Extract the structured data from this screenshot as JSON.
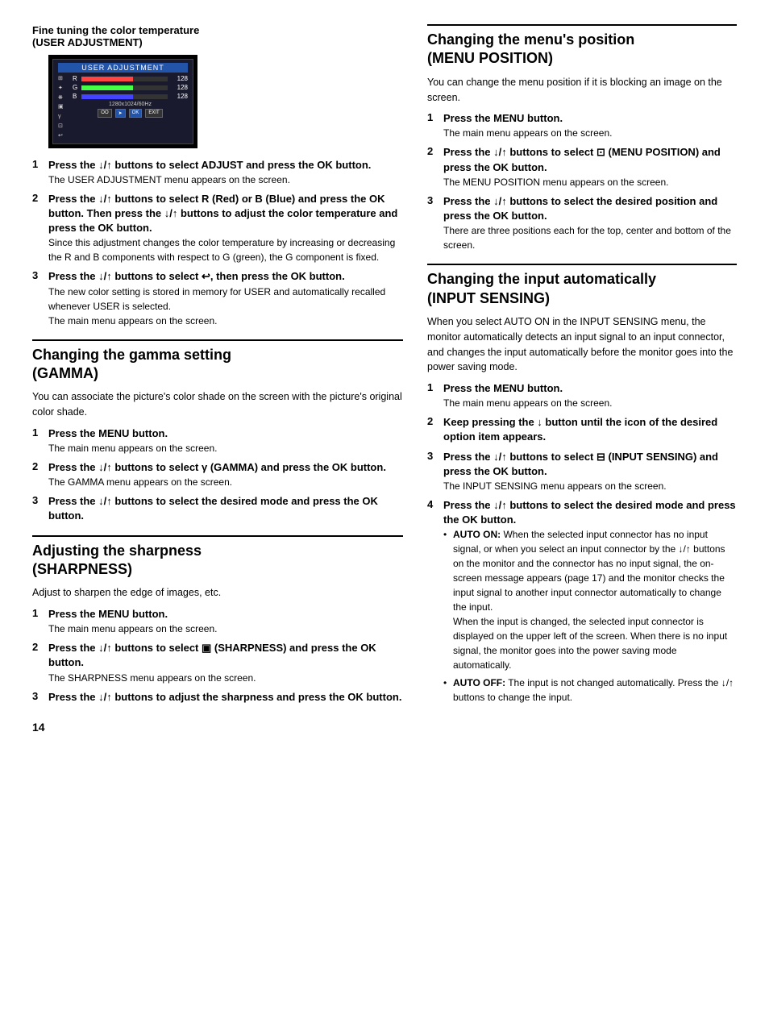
{
  "page": {
    "number": "14"
  },
  "fine_tuning": {
    "title": "Fine tuning the color temperature",
    "subtitle": "(USER ADJUSTMENT)",
    "monitor_title": "USER ADJUSTMENT",
    "monitor_res": "1280x1024/60Hz",
    "r_value": "128",
    "g_value": "128",
    "b_value": "128",
    "steps": [
      {
        "num": "1",
        "bold": "Press the ↓/↑ buttons to select ADJUST and press the OK button.",
        "desc": "The USER ADJUSTMENT menu appears on the screen."
      },
      {
        "num": "2",
        "bold": "Press the ↓/↑ buttons to select R (Red) or B (Blue) and press the OK button. Then press the ↓/↑ buttons to adjust the color temperature and press the OK button.",
        "desc": "Since this adjustment changes the color temperature by increasing or decreasing the R and B components with respect to G (green), the G component is fixed."
      },
      {
        "num": "3",
        "bold": "Press the ↓/↑ buttons to select ↩, then press the OK button.",
        "desc": "The new color setting is stored in memory for USER and automatically recalled whenever USER is selected.\nThe main menu appears on the screen."
      }
    ]
  },
  "gamma": {
    "title": "Changing the gamma setting",
    "subtitle": "(GAMMA)",
    "intro": "You can associate the picture's color shade on the screen with the picture's original color shade.",
    "steps": [
      {
        "num": "1",
        "bold": "Press the MENU button.",
        "desc": "The main menu appears on the screen."
      },
      {
        "num": "2",
        "bold": "Press the ↓/↑ buttons to select γ (GAMMA) and press the OK button.",
        "desc": "The GAMMA menu appears on the screen."
      },
      {
        "num": "3",
        "bold": "Press the ↓/↑ buttons to select the desired mode and press the OK button.",
        "desc": ""
      }
    ]
  },
  "sharpness": {
    "title": "Adjusting the sharpness",
    "subtitle": "(SHARPNESS)",
    "intro": "Adjust to sharpen the edge of images, etc.",
    "steps": [
      {
        "num": "1",
        "bold": "Press the MENU button.",
        "desc": "The main menu appears on the screen."
      },
      {
        "num": "2",
        "bold": "Press the ↓/↑ buttons to select  (SHARPNESS) and press the OK button.",
        "desc": "The SHARPNESS menu appears on the screen."
      },
      {
        "num": "3",
        "bold": "Press the ↓/↑ buttons to adjust the sharpness and press the OK button.",
        "desc": ""
      }
    ]
  },
  "menu_position": {
    "title": "Changing the menu's position",
    "subtitle": "(MENU POSITION)",
    "intro": "You can change the menu position if it is blocking an image on the screen.",
    "steps": [
      {
        "num": "1",
        "bold": "Press the MENU button.",
        "desc": "The main menu appears on the screen."
      },
      {
        "num": "2",
        "bold": "Press the ↓/↑ buttons to select  (MENU POSITION) and press the OK button.",
        "desc": "The MENU POSITION menu appears on the screen."
      },
      {
        "num": "3",
        "bold": "Press the ↓/↑ buttons to select the desired position and press the OK button.",
        "desc": "There are three positions each for the top, center and bottom of the screen."
      }
    ]
  },
  "input_sensing": {
    "title": "Changing the input automatically",
    "subtitle": "(INPUT SENSING)",
    "intro": "When you select AUTO ON in the INPUT SENSING menu, the monitor automatically detects an input signal to an input connector, and changes the input automatically before the monitor goes into the power saving mode.",
    "steps": [
      {
        "num": "1",
        "bold": "Press the MENU button.",
        "desc": "The main menu appears on the screen."
      },
      {
        "num": "2",
        "bold": "Keep pressing the ↓ button until the icon of the desired option item appears.",
        "desc": ""
      },
      {
        "num": "3",
        "bold": "Press the ↓/↑ buttons to select  (INPUT SENSING) and press the OK button.",
        "desc": "The INPUT SENSING menu appears on the screen."
      },
      {
        "num": "4",
        "bold": "Press the ↓/↑ buttons to select the desired mode and press the OK button.",
        "desc": ""
      }
    ],
    "bullets": [
      {
        "label": "AUTO ON:",
        "text": "When the selected input connector has no input signal, or when you select an input connector by the ↓/↑ buttons on the monitor and the connector has no input signal, the on-screen message appears (page 17) and the monitor checks the input signal to another input connector automatically to change the input.\nWhen the input is changed, the selected input connector is displayed on the upper left of the screen. When there is no input signal, the monitor goes into the power saving mode automatically."
      },
      {
        "label": "AUTO OFF:",
        "text": "The input is not changed automatically. Press the ↓/↑ buttons to change the input."
      }
    ]
  }
}
